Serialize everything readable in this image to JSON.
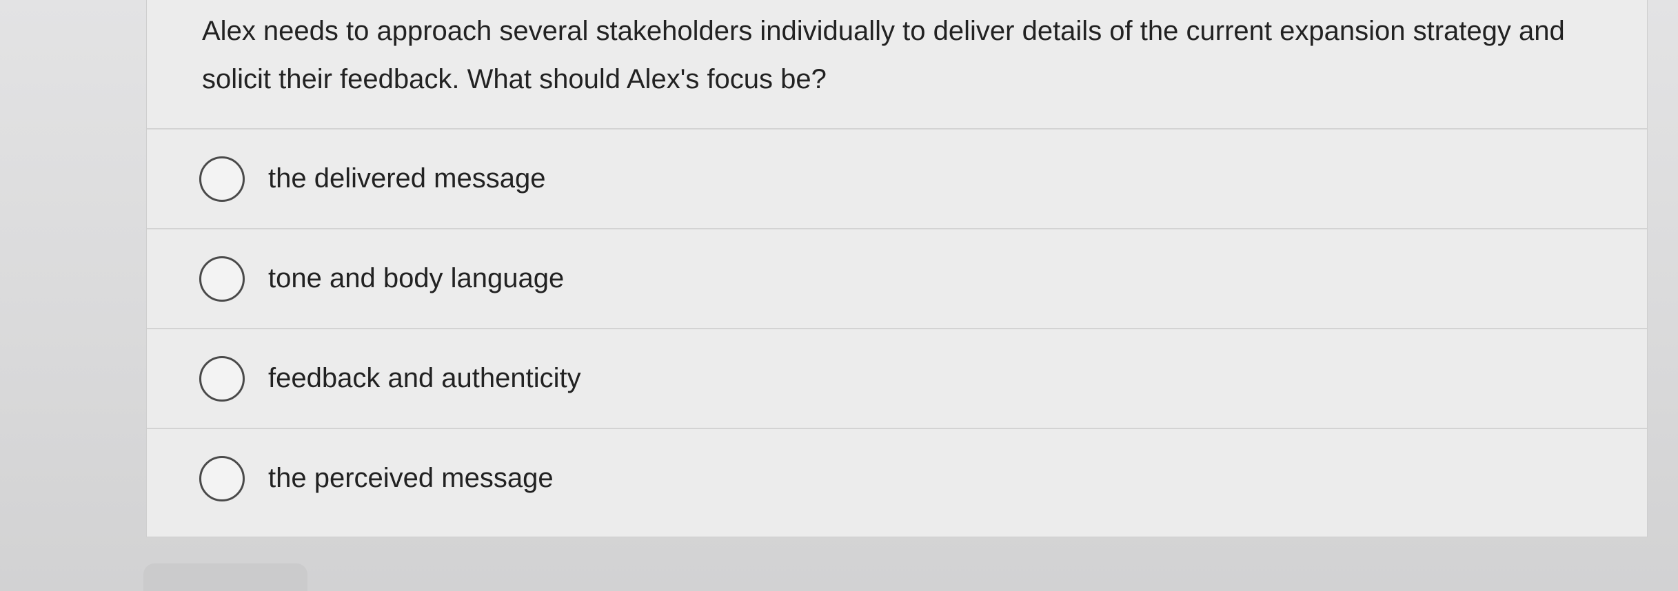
{
  "question": {
    "text": "Alex needs to approach several stakeholders individually to deliver details of the current expansion strategy and solicit their feedback. What should Alex's focus be?"
  },
  "options": [
    {
      "label": "the delivered message"
    },
    {
      "label": "tone and body language"
    },
    {
      "label": "feedback and authenticity"
    },
    {
      "label": "the perceived message"
    }
  ]
}
